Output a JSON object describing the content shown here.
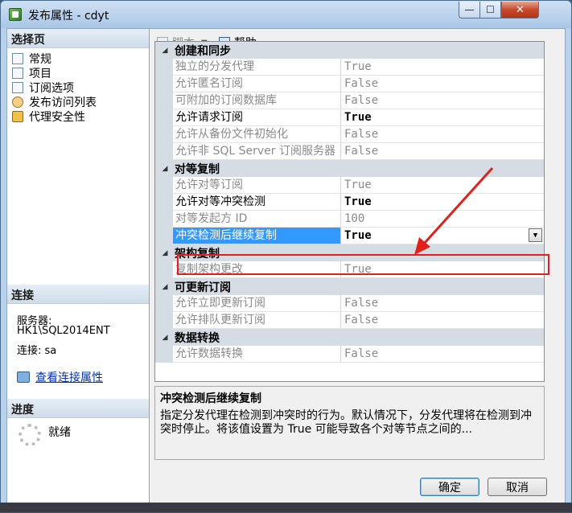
{
  "window": {
    "title": "发布属性 - cdyt",
    "minimize_glyph": "—",
    "maximize_glyph": "☐",
    "close_glyph": "✕"
  },
  "left": {
    "select_page_header": "选择页",
    "pages": [
      {
        "label": "常规",
        "icon": "page-icon"
      },
      {
        "label": "项目",
        "icon": "page-icon"
      },
      {
        "label": "订阅选项",
        "icon": "page-icon"
      },
      {
        "label": "发布访问列表",
        "icon": "people-icon"
      },
      {
        "label": "代理安全性",
        "icon": "lock-icon"
      }
    ],
    "connection_header": "连接",
    "server_label": "服务器:",
    "server_value": "HK1\\SQL2014ENT",
    "connection_value": "连接: sa",
    "view_connection_link": "查看连接属性",
    "progress_header": "进度",
    "progress_status": "就绪"
  },
  "toolbar": {
    "script_label": "脚本",
    "dropdown_glyph": "▼",
    "help_label": "帮助"
  },
  "grid": {
    "categories": [
      {
        "name": "创建和同步",
        "props": [
          {
            "name": "独立的分发代理",
            "value": "True",
            "style": "disabled"
          },
          {
            "name": "允许匿名订阅",
            "value": "False",
            "style": "disabled"
          },
          {
            "name": "可附加的订阅数据库",
            "value": "False",
            "style": "disabled"
          },
          {
            "name": "允许请求订阅",
            "value": "True",
            "style": "bold"
          },
          {
            "name": "允许从备份文件初始化",
            "value": "False",
            "style": "disabled"
          },
          {
            "name": "允许非 SQL Server 订阅服务器",
            "value": "False",
            "style": "disabled"
          }
        ]
      },
      {
        "name": "对等复制",
        "props": [
          {
            "name": "允许对等订阅",
            "value": "True",
            "style": "disabled"
          },
          {
            "name": "允许对等冲突检测",
            "value": "True",
            "style": "bold"
          },
          {
            "name": "对等发起方 ID",
            "value": "100",
            "style": "disabled"
          },
          {
            "name": "冲突检测后继续复制",
            "value": "True",
            "style": "selected"
          }
        ]
      },
      {
        "name": "架构复制",
        "props": [
          {
            "name": "复制架构更改",
            "value": "True",
            "style": "disabled"
          }
        ]
      },
      {
        "name": "可更新订阅",
        "props": [
          {
            "name": "允许立即更新订阅",
            "value": "False",
            "style": "disabled"
          },
          {
            "name": "允许排队更新订阅",
            "value": "False",
            "style": "disabled"
          }
        ]
      },
      {
        "name": "数据转换",
        "props": [
          {
            "name": "允许数据转换",
            "value": "False",
            "style": "disabled"
          }
        ]
      }
    ],
    "collapse_glyph": "◢",
    "select_glyph": "▼"
  },
  "description": {
    "title": "冲突检测后继续复制",
    "body": "指定分发代理在检测到冲突时的行为。默认情况下，分发代理将在检测到冲突时停止。将该值设置为 True 可能导致各个对等节点之间的..."
  },
  "buttons": {
    "ok": "确定",
    "cancel": "取消"
  },
  "annotation": {
    "color": "#e0201c"
  }
}
